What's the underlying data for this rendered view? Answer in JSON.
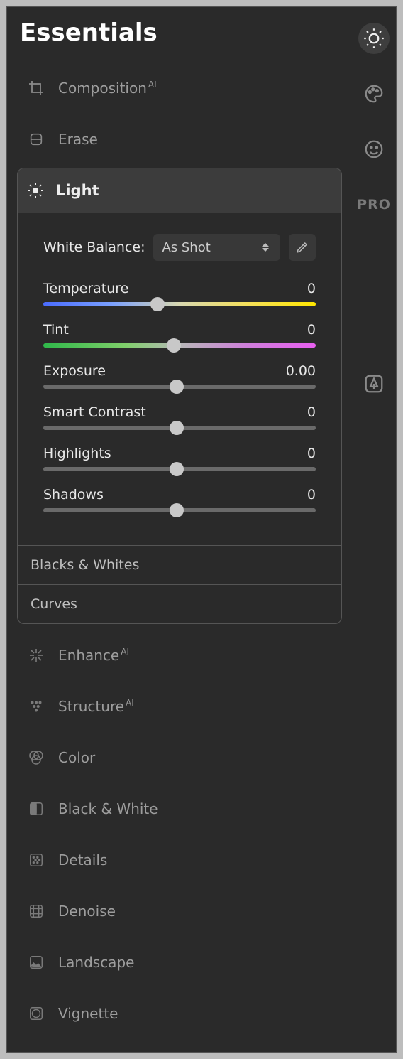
{
  "title": "Essentials",
  "tools": {
    "composition": {
      "label": "Composition",
      "badge": "AI"
    },
    "erase": {
      "label": "Erase"
    },
    "enhance": {
      "label": "Enhance",
      "badge": "AI"
    },
    "structure": {
      "label": "Structure",
      "badge": "AI"
    },
    "color": {
      "label": "Color"
    },
    "bw": {
      "label": "Black & White"
    },
    "details": {
      "label": "Details"
    },
    "denoise": {
      "label": "Denoise"
    },
    "landscape": {
      "label": "Landscape"
    },
    "vignette": {
      "label": "Vignette"
    }
  },
  "light_panel": {
    "title": "Light",
    "wb_label": "White Balance:",
    "wb_value": "As Shot",
    "sliders": {
      "temperature": {
        "label": "Temperature",
        "value": "0",
        "pos": 42
      },
      "tint": {
        "label": "Tint",
        "value": "0",
        "pos": 48
      },
      "exposure": {
        "label": "Exposure",
        "value": "0.00",
        "pos": 49
      },
      "smart_contrast": {
        "label": "Smart Contrast",
        "value": "0",
        "pos": 49
      },
      "highlights": {
        "label": "Highlights",
        "value": "0",
        "pos": 49
      },
      "shadows": {
        "label": "Shadows",
        "value": "0",
        "pos": 49
      }
    },
    "subsections": {
      "blacks_whites": "Blacks & Whites",
      "curves": "Curves"
    }
  },
  "sidebar": {
    "pro": "PRO"
  }
}
